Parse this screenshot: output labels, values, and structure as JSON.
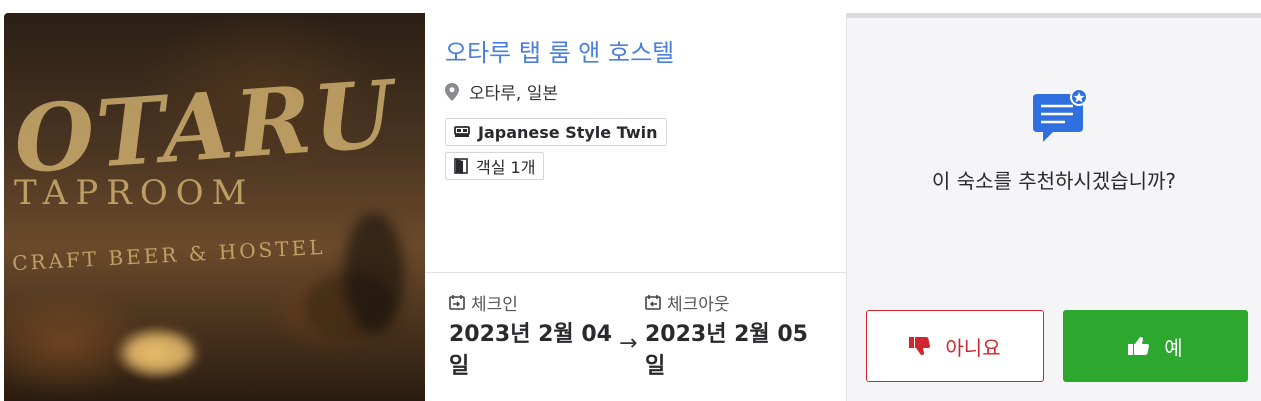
{
  "photo": {
    "sign_line1": "OTARU",
    "sign_line2": "TAPROOM",
    "sign_line3": "CRAFT BEER & HOSTEL"
  },
  "hotel": {
    "name": "오타루 탭 룸 앤 호스텔",
    "location": "오타루, 일본",
    "room_type": "Japanese Style Twin",
    "room_count": "객실 1개"
  },
  "stay": {
    "checkin_label": "체크인",
    "checkin_date": "2023년 2월 04일",
    "checkout_label": "체크아웃",
    "checkout_date": "2023년 2월 05일",
    "arrow": "→"
  },
  "feedback": {
    "question": "이 숙소를 추천하시겠습니까?",
    "no_label": "아니요",
    "yes_label": "예"
  },
  "colors": {
    "link": "#4a7fe0",
    "no": "#d0262d",
    "yes": "#2ea72f",
    "icon_blue": "#2f6fe0"
  },
  "icons": [
    "location-pin-icon",
    "bed-icon",
    "door-icon",
    "calendar-checkin-icon",
    "calendar-checkout-icon",
    "chat-star-icon",
    "thumbs-down-icon",
    "thumbs-up-icon"
  ]
}
